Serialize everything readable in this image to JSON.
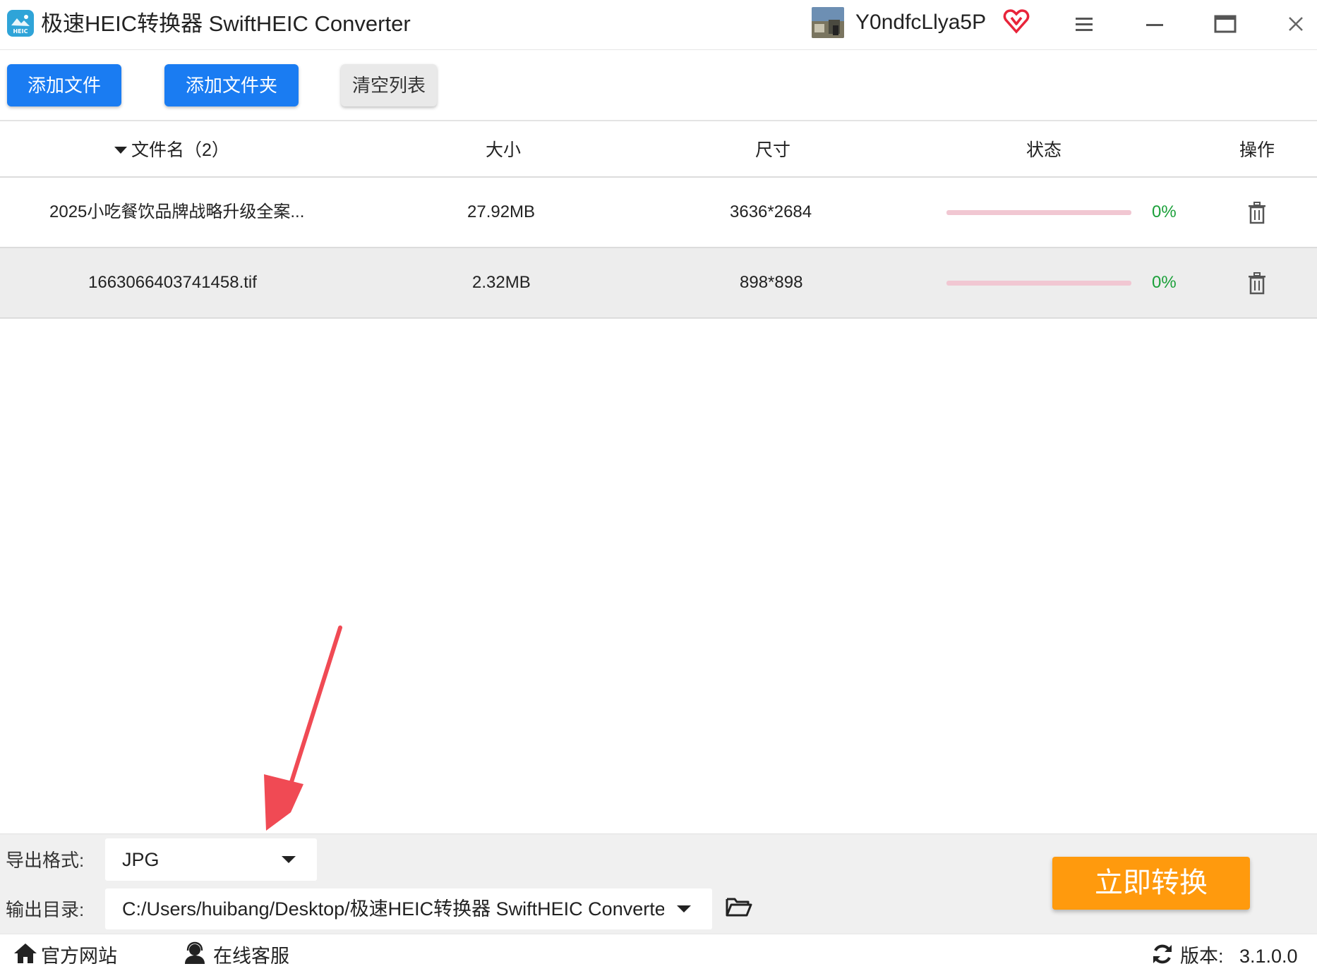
{
  "window": {
    "title": "极速HEIC转换器 SwiftHEIC Converter",
    "username": "Y0ndfcLlya5P",
    "app_icon_text": "HEIC"
  },
  "toolbar": {
    "add_file_label": "添加文件",
    "add_folder_label": "添加文件夹",
    "clear_list_label": "清空列表"
  },
  "table": {
    "headers": {
      "filename": "文件名（2）",
      "size": "大小",
      "dimensions": "尺寸",
      "status": "状态",
      "actions": "操作"
    },
    "rows": [
      {
        "filename": "2025小吃餐饮品牌战略升级全案...",
        "size": "27.92MB",
        "dimensions": "3636*2684",
        "progress": "0%"
      },
      {
        "filename": "1663066403741458.tif",
        "size": "2.32MB",
        "dimensions": "898*898",
        "progress": "0%"
      }
    ]
  },
  "output": {
    "format_label": "导出格式:",
    "format_value": "JPG",
    "dir_label": "输出目录:",
    "dir_value": "C:/Users/huibang/Desktop/极速HEIC转换器 SwiftHEIC Converter"
  },
  "convert_label": "立即转换",
  "footer": {
    "website_label": "官方网站",
    "support_label": "在线客服",
    "version_label": "版本:",
    "version_value": "3.1.0.0"
  },
  "colors": {
    "primary_blue": "#1a7cf2",
    "convert_orange": "#ff9a0d",
    "progress_pink": "#f1c7d2",
    "percent_green": "#1ba03a",
    "arrow_red": "#f04a54"
  }
}
